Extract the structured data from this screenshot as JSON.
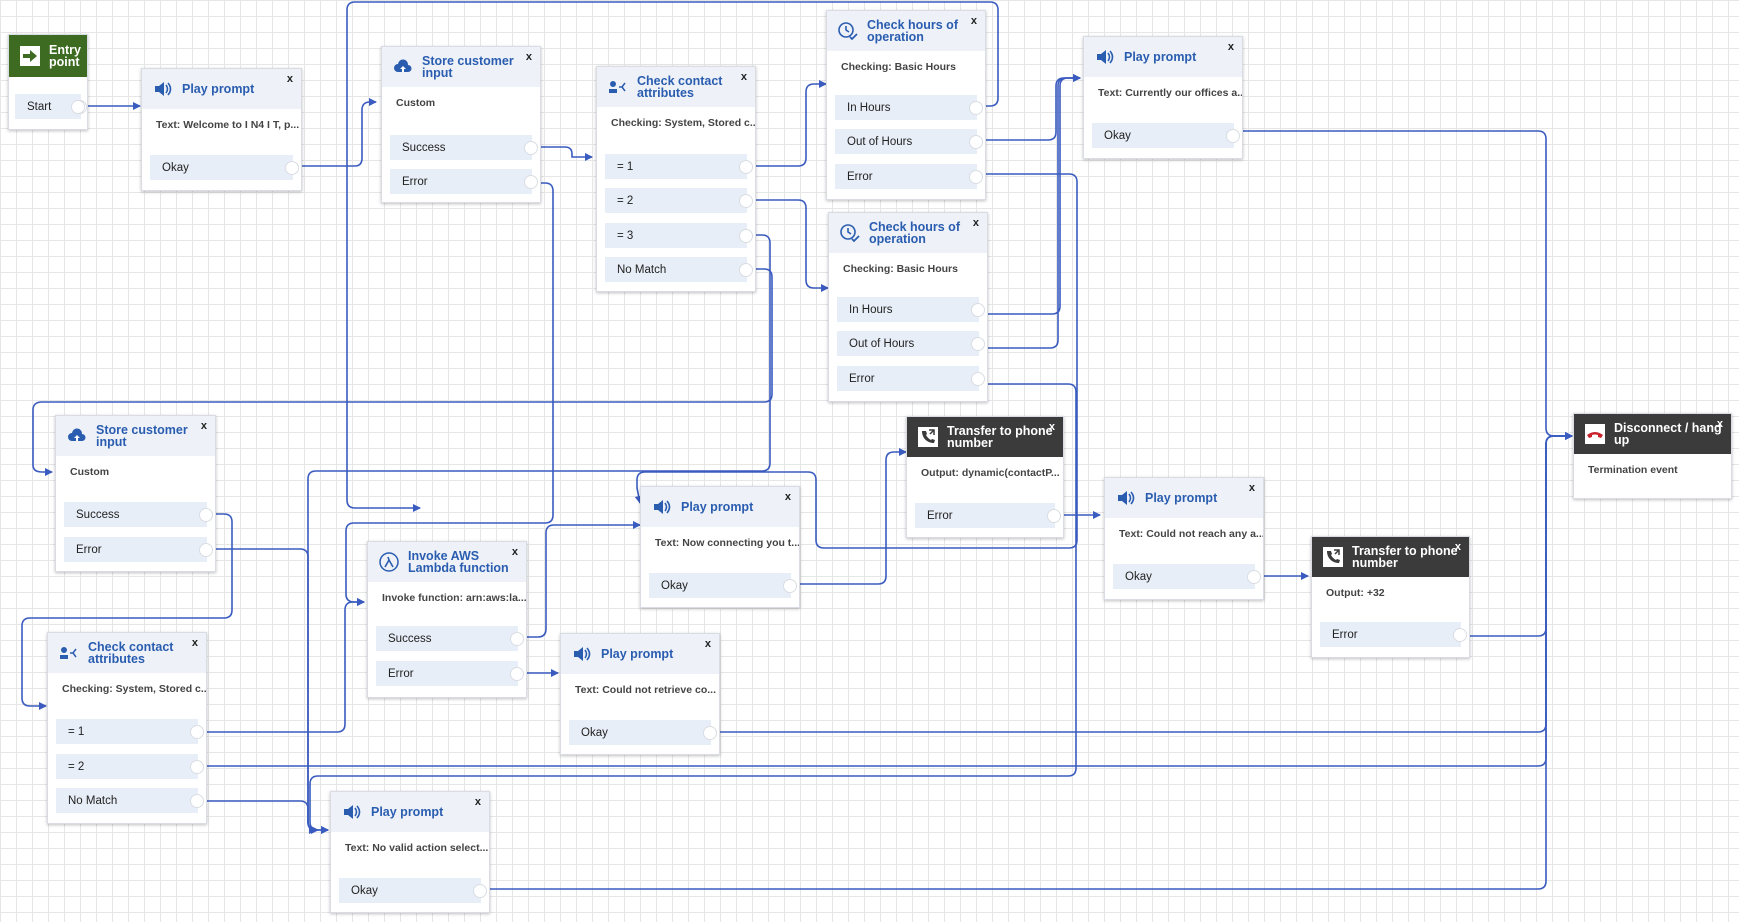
{
  "colors": {
    "wire": "#3a5bbf",
    "header": "#eef2f8",
    "title": "#2a5db0",
    "branch": "#e8eef7",
    "entry": "#3d6b21",
    "dark": "#3b3b3b",
    "disconnect_icon": "#c8232c"
  },
  "blocks": {
    "entry": {
      "title": "Entry point",
      "icon": "arrow-right-icon",
      "branches": [
        "Start"
      ]
    },
    "play1": {
      "title": "Play prompt",
      "icon": "speaker-icon",
      "close": "x",
      "desc": "Text: Welcome to I N4 I T, p...",
      "branches": [
        "Okay"
      ]
    },
    "store1": {
      "title": "Store customer input",
      "icon": "cloud-upload-icon",
      "close": "x",
      "desc": "Custom",
      "branches": [
        "Success",
        "Error"
      ]
    },
    "check1": {
      "title": "Check contact attributes",
      "icon": "attributes-icon",
      "close": "x",
      "desc": "Checking: System, Stored c...",
      "branches": [
        "= 1",
        "= 2",
        "= 3",
        "No Match"
      ]
    },
    "hours1": {
      "title": "Check hours of operation",
      "icon": "clock-check-icon",
      "close": "x",
      "desc": "Checking: Basic Hours",
      "branches": [
        "In Hours",
        "Out of Hours",
        "Error"
      ]
    },
    "hours2": {
      "title": "Check hours of operation",
      "icon": "clock-check-icon",
      "close": "x",
      "desc": "Checking: Basic Hours",
      "branches": [
        "In Hours",
        "Out of Hours",
        "Error"
      ]
    },
    "play2": {
      "title": "Play prompt",
      "icon": "speaker-icon",
      "close": "x",
      "desc": "Text: Currently our offices a...",
      "branches": [
        "Okay"
      ]
    },
    "store2": {
      "title": "Store customer input",
      "icon": "cloud-upload-icon",
      "close": "x",
      "desc": "Custom",
      "branches": [
        "Success",
        "Error"
      ]
    },
    "transfer1": {
      "title": "Transfer to phone number",
      "icon": "phone-transfer-icon",
      "close": "x",
      "desc": "Output: dynamic(contactP...",
      "branches": [
        "Error"
      ]
    },
    "play3": {
      "title": "Play prompt",
      "icon": "speaker-icon",
      "close": "x",
      "desc": "Text: Now connecting you t...",
      "branches": [
        "Okay"
      ]
    },
    "lambda": {
      "title": "Invoke AWS Lambda function",
      "icon": "lambda-icon",
      "close": "x",
      "desc": "Invoke function: arn:aws:la...",
      "branches": [
        "Success",
        "Error"
      ]
    },
    "play4": {
      "title": "Play prompt",
      "icon": "speaker-icon",
      "close": "x",
      "desc": "Text: Could not reach any a...",
      "branches": [
        "Okay"
      ]
    },
    "transfer2": {
      "title": "Transfer to phone number",
      "icon": "phone-transfer-icon",
      "close": "x",
      "desc": "Output: +32",
      "branches": [
        "Error"
      ]
    },
    "disconnect": {
      "title": "Disconnect / hang up",
      "icon": "hang-up-icon",
      "close": "x",
      "desc": "Termination event",
      "branches": []
    },
    "check2": {
      "title": "Check contact attributes",
      "icon": "attributes-icon",
      "close": "x",
      "desc": "Checking: System, Stored c...",
      "branches": [
        "= 1",
        "= 2",
        "No Match"
      ]
    },
    "play5": {
      "title": "Play prompt",
      "icon": "speaker-icon",
      "close": "x",
      "desc": "Text: Could not retrieve co...",
      "branches": [
        "Okay"
      ]
    },
    "play6": {
      "title": "Play prompt",
      "icon": "speaker-icon",
      "close": "x",
      "desc": "Text: No valid action select...",
      "branches": [
        "Okay"
      ]
    }
  }
}
